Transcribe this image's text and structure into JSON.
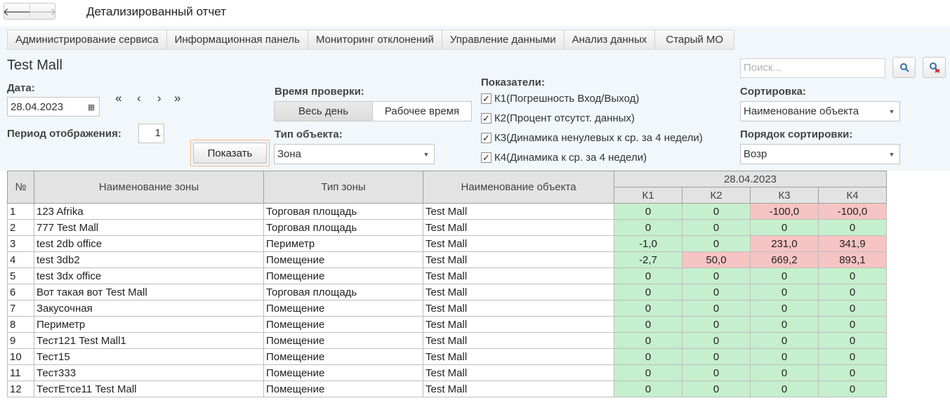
{
  "window": {
    "title": "Детализированный отчет",
    "back_glyph": "🡐",
    "forward_glyph": "🡒"
  },
  "menu": [
    "Администрирование сервиса",
    "Информационная панель",
    "Мониторинг отклонений",
    "Управление данными",
    "Анализ данных",
    "Старый МО"
  ],
  "form": {
    "object_title": "Test Mall",
    "date_label": "Дата:",
    "date_value": "28.04.2023",
    "date_nav": [
      "«",
      "‹",
      "›",
      "»"
    ],
    "period_label": "Период отображения:",
    "period_value": "1",
    "show_button": "Показать",
    "check_time_label": "Время проверки:",
    "time_options": [
      "Весь день",
      "Рабочее время"
    ],
    "object_type_label": "Тип объекта:",
    "object_type_value": "Зона",
    "indicators_label": "Показатели:",
    "indicators": [
      "К1(Погрешность Вход/Выход)",
      "К2(Процент отсутст. данных)",
      "К3(Динамика ненулевых к ср. за 4 недели)",
      "К4(Динамика к ср. за 4 недели)"
    ],
    "search_placeholder": "Поиск...",
    "sort_label": "Сортировка:",
    "sort_value": "Наименование объекта",
    "sort_order_label": "Порядок сортировки:",
    "sort_order_value": "Возр"
  },
  "table": {
    "headers": {
      "num": "№",
      "zone_name": "Наименование зоны",
      "zone_type": "Тип зоны",
      "object_name": "Наименование объекта",
      "date_group": "28.04.2023",
      "k": [
        "К1",
        "К2",
        "К3",
        "К4"
      ]
    },
    "rows": [
      {
        "num": "1",
        "zone": "123 Afrika",
        "type": "Торговая площадь",
        "object": "Test Mall",
        "k": [
          "0",
          "0",
          "-100,0",
          "-100,0"
        ]
      },
      {
        "num": "2",
        "zone": "777 Test Mall",
        "type": "Торговая площадь",
        "object": "Test Mall",
        "k": [
          "0",
          "0",
          "0",
          "0"
        ]
      },
      {
        "num": "3",
        "zone": "test 2db office",
        "type": "Периметр",
        "object": "Test Mall",
        "k": [
          "-1,0",
          "0",
          "231,0",
          "341,9"
        ]
      },
      {
        "num": "4",
        "zone": "test 3db2",
        "type": "Помещение",
        "object": "Test Mall",
        "k": [
          "-2,7",
          "50,0",
          "669,2",
          "893,1"
        ]
      },
      {
        "num": "5",
        "zone": "test 3dx office",
        "type": "Помещение",
        "object": "Test Mall",
        "k": [
          "0",
          "0",
          "0",
          "0"
        ]
      },
      {
        "num": "6",
        "zone": "Вот такая вот Test Mall",
        "type": "Торговая площадь",
        "object": "Test Mall",
        "k": [
          "0",
          "0",
          "0",
          "0"
        ]
      },
      {
        "num": "7",
        "zone": "Закусочная",
        "type": "Помещение",
        "object": "Test Mall",
        "k": [
          "0",
          "0",
          "0",
          "0"
        ]
      },
      {
        "num": "8",
        "zone": "Периметр",
        "type": "Помещение",
        "object": "Test Mall",
        "k": [
          "0",
          "0",
          "0",
          "0"
        ]
      },
      {
        "num": "9",
        "zone": "Тест121 Test Mall1",
        "type": "Помещение",
        "object": "Test Mall",
        "k": [
          "0",
          "0",
          "0",
          "0"
        ]
      },
      {
        "num": "10",
        "zone": "Тест15",
        "type": "Помещение",
        "object": "Test Mall",
        "k": [
          "0",
          "0",
          "0",
          "0"
        ]
      },
      {
        "num": "11",
        "zone": "Тест333",
        "type": "Помещение",
        "object": "Test Mall",
        "k": [
          "0",
          "0",
          "0",
          "0"
        ]
      },
      {
        "num": "12",
        "zone": "ТестЕтсе11 Test Mall",
        "type": "Помещение",
        "object": "Test Mall",
        "k": [
          "0",
          "0",
          "0",
          "0"
        ]
      }
    ],
    "cell_status": [
      [
        "ok",
        "ok",
        "bad",
        "bad"
      ],
      [
        "ok",
        "ok",
        "ok",
        "ok"
      ],
      [
        "ok",
        "ok",
        "bad",
        "bad"
      ],
      [
        "ok",
        "bad",
        "bad",
        "bad"
      ],
      [
        "ok",
        "ok",
        "ok",
        "ok"
      ],
      [
        "ok",
        "ok",
        "ok",
        "ok"
      ],
      [
        "ok",
        "ok",
        "ok",
        "ok"
      ],
      [
        "ok",
        "ok",
        "ok",
        "ok"
      ],
      [
        "ok",
        "ok",
        "ok",
        "ok"
      ],
      [
        "ok",
        "ok",
        "ok",
        "ok"
      ],
      [
        "ok",
        "ok",
        "ok",
        "ok"
      ],
      [
        "ok",
        "ok",
        "ok",
        "ok"
      ]
    ]
  },
  "colors": {
    "ok": "#c6efce",
    "bad": "#f6c4c3",
    "panel": "#f2f7fb",
    "header": "#e3e3e3",
    "show_button_focus": "#f0b98a"
  }
}
